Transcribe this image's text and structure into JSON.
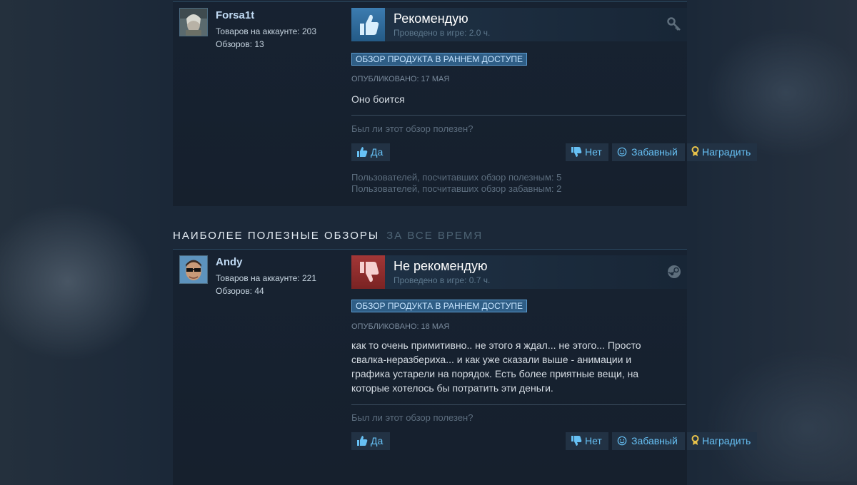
{
  "review1": {
    "user": {
      "name": "Forsa1t",
      "products": "Товаров на аккаунте: 203",
      "reviews": "Обзоров: 13"
    },
    "verdict": "Рекомендую",
    "hours": "Проведено в игре: 2.0 ч.",
    "source_icon": "key-icon",
    "badge": "ОБЗОР ПРОДУКТА В РАННЕМ ДОСТУПЕ",
    "posted": "ОПУБЛИКОВАНО: 17 МАЯ",
    "text": "Оно боится",
    "helpful_question": "Был ли этот обзор полезен?",
    "buttons": {
      "yes": "Да",
      "no": "Нет",
      "funny": "Забавный",
      "award": "Наградить"
    },
    "helpful_count": "Пользователей, посчитавших обзор полезным: 5",
    "funny_count": "Пользователей, посчитавших обзор забавным: 2"
  },
  "section": {
    "title": "НАИБОЛЕЕ ПОЛЕЗНЫЕ ОБЗОРЫ",
    "period": "ЗА ВСЕ ВРЕМЯ"
  },
  "review2": {
    "user": {
      "name": "Andy",
      "products": "Товаров на аккаунте: 221",
      "reviews": "Обзоров: 44"
    },
    "verdict": "Не рекомендую",
    "hours": "Проведено в игре: 0.7 ч.",
    "source_icon": "steam-icon",
    "badge": "ОБЗОР ПРОДУКТА В РАННЕМ ДОСТУПЕ",
    "posted": "ОПУБЛИКОВАНО: 18 МАЯ",
    "text_lines": [
      "как то очень примитивно.. не этого я ждал... не этого... Просто",
      "свалка-неразбериха... и как уже сказали выше - анимации и",
      "графика устарели на порядок. Есть более приятные вещи, на",
      "которые хотелось бы потратить эти деньги."
    ],
    "helpful_question": "Был ли этот обзор полезен?",
    "buttons": {
      "yes": "Да",
      "no": "Нет",
      "funny": "Забавный",
      "award": "Наградить"
    }
  },
  "colors": {
    "accent": "#67c1f5",
    "thumb_up": "#2e6a9a",
    "thumb_down": "#8a2a2a",
    "badge": "#2f5e86"
  }
}
